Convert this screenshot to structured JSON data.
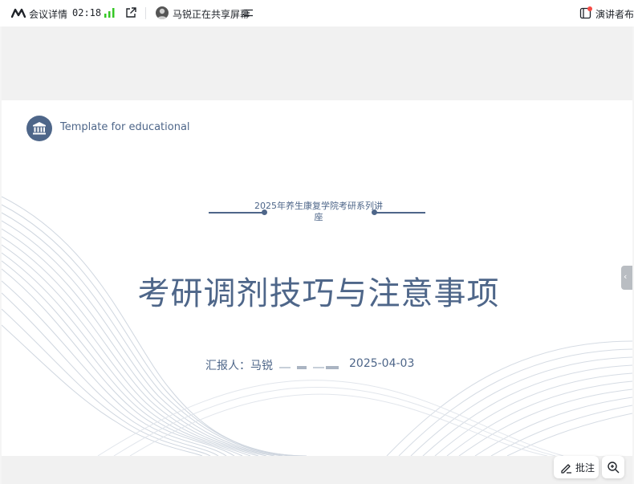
{
  "topbar": {
    "meeting_details": "会议详情",
    "timer": "02:18",
    "sharing_status": "马锐正在共享屏幕",
    "presenter_layout": "演讲者布局"
  },
  "slide": {
    "template_label": "Template for educational",
    "series_title": "2025年养生康复学院考研系列讲座",
    "main_title": "考研调剂技巧与注意事项",
    "reporter": "汇报人：马锐",
    "date": "2025-04-03"
  },
  "controls": {
    "annotate_label": "批注",
    "side_handle_glyph": "‹"
  },
  "colors": {
    "slide_accent": "#4e6689",
    "signal_green": "#34c724",
    "notification_red": "#f54a45"
  },
  "icons": [
    "meeting-logo-icon",
    "signal-icon",
    "share-out-icon",
    "menu-icon",
    "presenter-layout-icon",
    "bank-icon",
    "pen-icon",
    "zoom-in-icon"
  ]
}
